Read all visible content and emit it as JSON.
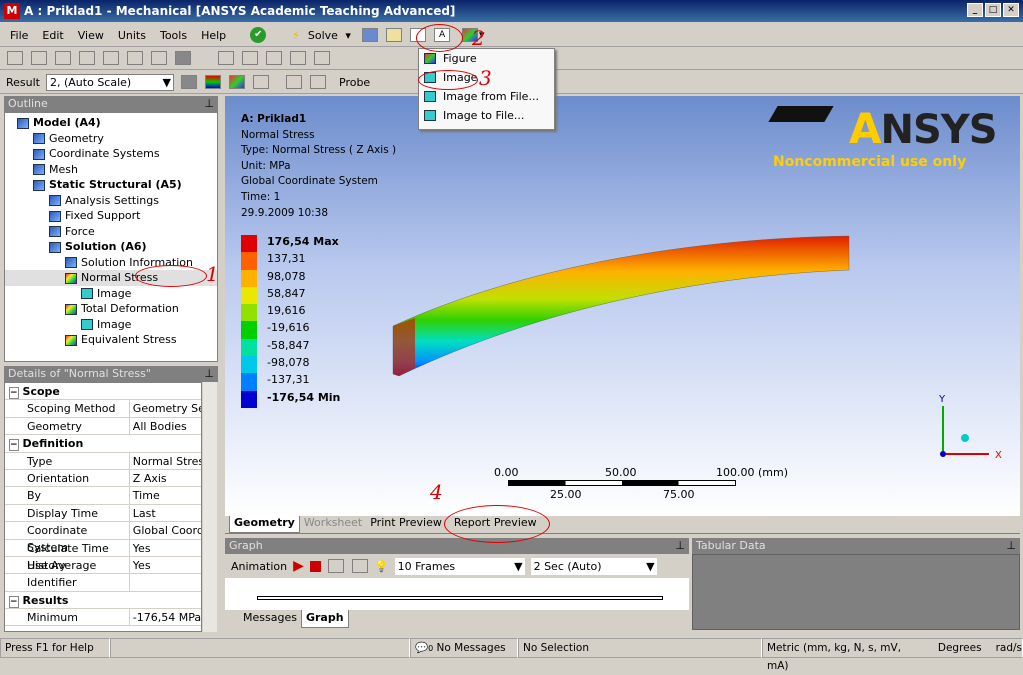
{
  "window": {
    "title": "A : Priklad1 - Mechanical [ANSYS Academic Teaching Advanced]"
  },
  "menu": [
    "File",
    "Edit",
    "View",
    "Units",
    "Tools",
    "Help"
  ],
  "toolbar": {
    "solve": "Solve",
    "result_label": "Result",
    "result_scale": "2, (Auto Scale)",
    "probe": "Probe"
  },
  "dropdown": {
    "items": [
      "Figure",
      "Image",
      "Image from File...",
      "Image to File..."
    ]
  },
  "outline": {
    "title": "Outline",
    "items": [
      {
        "label": "Model (A4)",
        "bold": true,
        "level": 0
      },
      {
        "label": "Geometry",
        "level": 1
      },
      {
        "label": "Coordinate Systems",
        "level": 1
      },
      {
        "label": "Mesh",
        "level": 1
      },
      {
        "label": "Static Structural (A5)",
        "bold": true,
        "level": 1
      },
      {
        "label": "Analysis Settings",
        "level": 2
      },
      {
        "label": "Fixed Support",
        "level": 2
      },
      {
        "label": "Force",
        "level": 2
      },
      {
        "label": "Solution (A6)",
        "bold": true,
        "level": 2
      },
      {
        "label": "Solution Information",
        "level": 3
      },
      {
        "label": "Normal Stress",
        "level": 3
      },
      {
        "label": "Image",
        "level": 4
      },
      {
        "label": "Total Deformation",
        "level": 3
      },
      {
        "label": "Image",
        "level": 4
      },
      {
        "label": "Equivalent Stress",
        "level": 3
      }
    ]
  },
  "details": {
    "title": "Details of \"Normal Stress\"",
    "sections": [
      {
        "name": "Scope",
        "rows": [
          [
            "Scoping Method",
            "Geometry Selection"
          ],
          [
            "Geometry",
            "All Bodies"
          ]
        ]
      },
      {
        "name": "Definition",
        "rows": [
          [
            "Type",
            "Normal Stress"
          ],
          [
            "Orientation",
            "Z Axis"
          ],
          [
            "By",
            "Time"
          ],
          [
            "Display Time",
            "Last"
          ],
          [
            "Coordinate System",
            "Global Coordinate System"
          ],
          [
            "Calculate Time History",
            "Yes"
          ],
          [
            "Use Average",
            "Yes"
          ],
          [
            "Identifier",
            ""
          ]
        ]
      },
      {
        "name": "Results",
        "rows": [
          [
            "Minimum",
            "-176,54 MPa"
          ]
        ]
      }
    ]
  },
  "viewport": {
    "info": [
      "A: Priklad1",
      "Normal Stress",
      "Type: Normal Stress ( Z Axis )",
      "Unit: MPa",
      "Global Coordinate System",
      "Time: 1",
      "29.9.2009 10:38"
    ],
    "legend": [
      "176,54 Max",
      "137,31",
      "98,078",
      "58,847",
      "19,616",
      "-19,616",
      "-58,847",
      "-98,078",
      "-137,31",
      "-176,54 Min"
    ],
    "legend_colors": [
      "#e00000",
      "#ff6000",
      "#ffb000",
      "#e8e800",
      "#90e000",
      "#00d000",
      "#00e0a0",
      "#00c8e8",
      "#0080ff",
      "#0000d0"
    ],
    "logo": "ANSYS",
    "watermark": "Noncommercial use only",
    "scale": {
      "top": [
        "0.00",
        "50.00",
        "100.00 (mm)"
      ],
      "bottom": [
        "25.00",
        "75.00"
      ]
    },
    "axes": [
      "Y",
      "X"
    ]
  },
  "view_tabs": [
    "Geometry",
    "Worksheet",
    "Print Preview",
    "Report Preview"
  ],
  "graph": {
    "title": "Graph",
    "animation": "Animation",
    "frames": "10 Frames",
    "duration": "2 Sec (Auto)",
    "tabs": [
      "Messages",
      "Graph"
    ]
  },
  "tabular": {
    "title": "Tabular Data"
  },
  "annotations": [
    "1",
    "2",
    "3",
    "4"
  ],
  "status": {
    "help": "Press F1 for Help",
    "messages_count": "0",
    "messages": "No Messages",
    "selection": "No Selection",
    "units": "Metric (mm, kg, N, s, mV, mA)",
    "angle": "Degrees",
    "rot": "rad/s"
  }
}
